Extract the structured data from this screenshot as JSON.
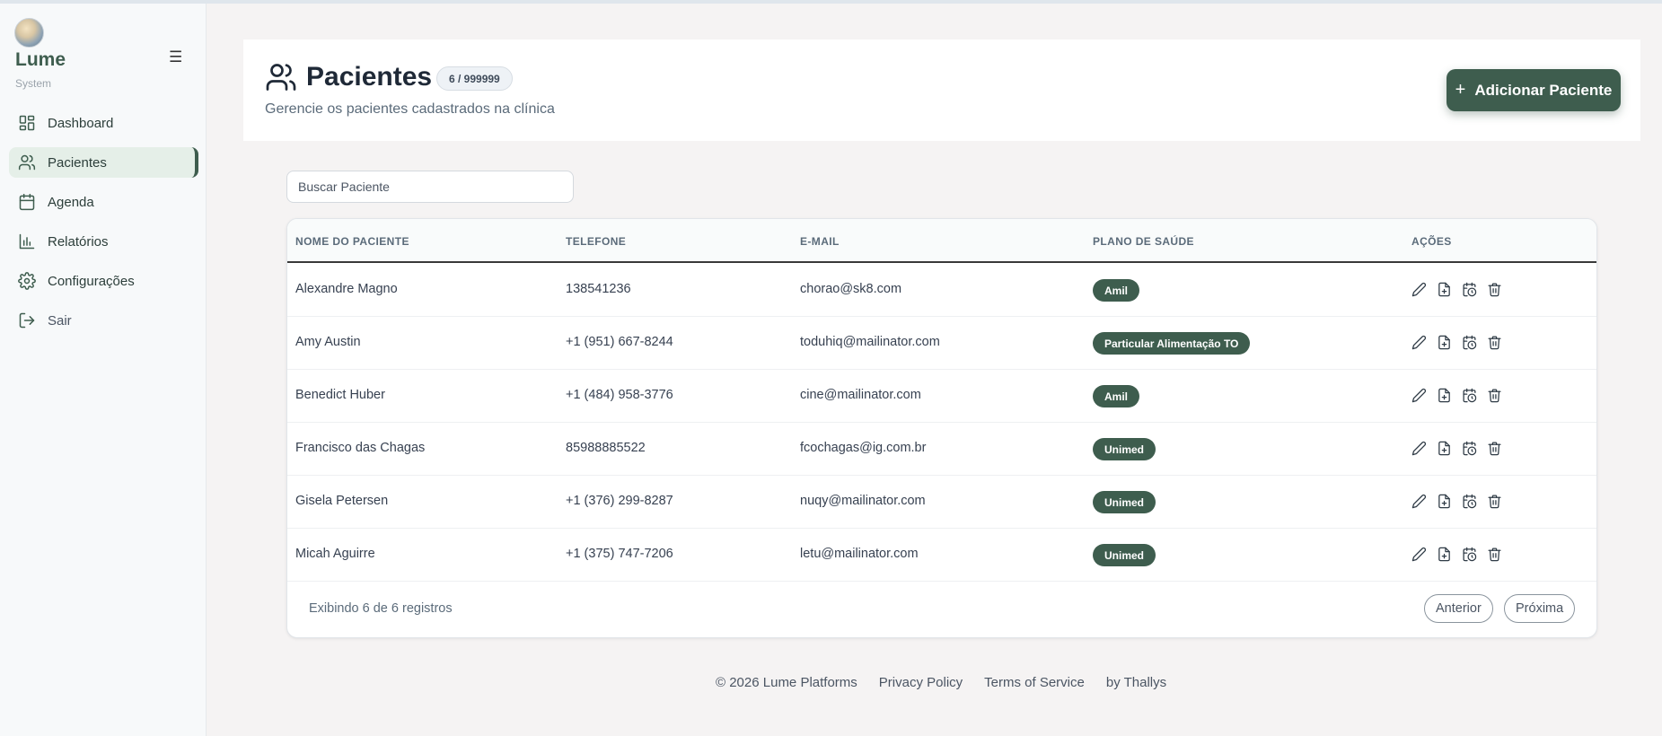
{
  "sidebar": {
    "brand": "Lume",
    "brand_sub": "System",
    "menu_icon": "hamburger-icon",
    "items": [
      {
        "label": "Dashboard",
        "icon": "dashboard-icon"
      },
      {
        "label": "Pacientes",
        "icon": "users-icon",
        "active": true
      },
      {
        "label": "Agenda",
        "icon": "calendar-icon"
      },
      {
        "label": "Relatórios",
        "icon": "bar-chart-icon"
      },
      {
        "label": "Configurações",
        "icon": "gear-icon"
      },
      {
        "label": "Sair",
        "icon": "logout-icon"
      }
    ]
  },
  "header": {
    "title": "Pacientes",
    "count_badge": "6 / 999999",
    "subtitle": "Gerencie os pacientes cadastrados na clínica",
    "add_button": "Adicionar Paciente"
  },
  "search": {
    "placeholder": "Buscar Paciente"
  },
  "table": {
    "columns": [
      "NOME DO PACIENTE",
      "TELEFONE",
      "E-MAIL",
      "PLANO DE SAÚDE",
      "AÇÕES"
    ],
    "rows": [
      {
        "name": "Alexandre Magno",
        "phone": "138541236",
        "email": "chorao@sk8.com",
        "plan": "Amil"
      },
      {
        "name": "Amy Austin",
        "phone": "+1 (951) 667-8244",
        "email": "toduhiq@mailinator.com",
        "plan": "Particular Alimentação TO"
      },
      {
        "name": "Benedict Huber",
        "phone": "+1 (484) 958-3776",
        "email": "cine@mailinator.com",
        "plan": "Amil"
      },
      {
        "name": "Francisco das Chagas",
        "phone": "85988885522",
        "email": "fcochagas@ig.com.br",
        "plan": "Unimed"
      },
      {
        "name": "Gisela Petersen",
        "phone": "+1 (376) 299-8287",
        "email": "nuqy@mailinator.com",
        "plan": "Unimed"
      },
      {
        "name": "Micah Aguirre",
        "phone": "+1 (375) 747-7206",
        "email": "letu@mailinator.com",
        "plan": "Unimed"
      }
    ],
    "action_icons": [
      "edit-icon",
      "file-plus-icon",
      "calendar-clock-icon",
      "trash-icon"
    ],
    "footer_info": "Exibindo 6 de 6 registros",
    "prev_label": "Anterior",
    "next_label": "Próxima"
  },
  "footer": {
    "copyright": "© 2026 Lume Platforms",
    "privacy": "Privacy Policy",
    "terms": "Terms of Service",
    "author": "by Thallys"
  },
  "colors": {
    "accent": "#3e5d4e",
    "active_bg": "#e5efe8"
  }
}
